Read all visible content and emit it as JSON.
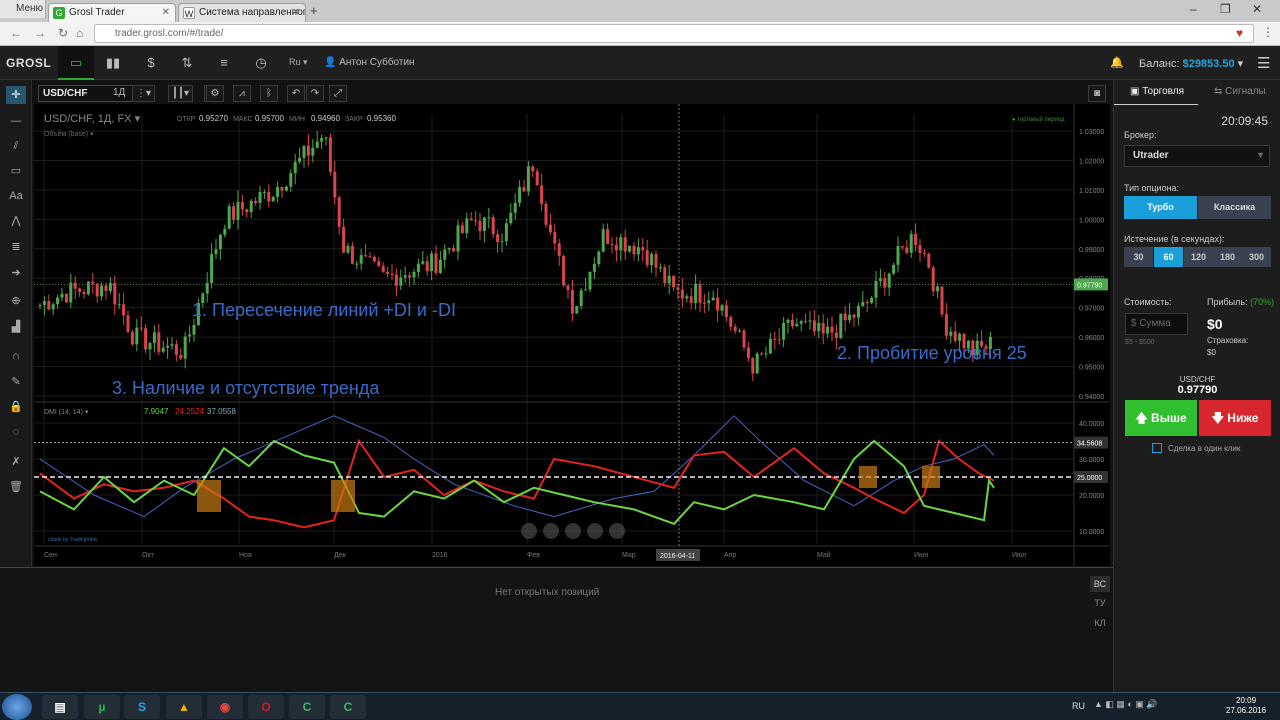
{
  "browser": {
    "menu_label": "Меню",
    "tabs": [
      {
        "label": "Grosl Trader",
        "icon": "grosl-icon",
        "color": "#31a82f"
      },
      {
        "label": "Система направленного д",
        "icon": "wikipedia-icon",
        "color": "#888888"
      }
    ],
    "url": "trader.grosl.com/#/trade/"
  },
  "app": {
    "logo": "GROSL",
    "language": "Ru",
    "user": "Антон Субботин",
    "balance_label": "Баланс:",
    "balance_value": "$29853.50"
  },
  "chart_header": {
    "symbol": "USD/CHF",
    "interval": "1Д",
    "title": "USD/CHF, 1Д, FX",
    "open_label": "ОТКР",
    "open": "0.95270",
    "high_label": "МАКС",
    "high": "0.95700",
    "low_label": "МИН",
    "low": "0.94960",
    "close_label": "ЗАКР",
    "close": "0.95360",
    "volume_label": "Объём (base)",
    "trading_period": "торговый период",
    "current_price": "0.97790"
  },
  "dmi_header": {
    "label": "DMI (14, 14)",
    "plus_di": "7.9047",
    "minus_di": "24.2524",
    "adx": "37.0558",
    "level_label": "34.5608",
    "threshold_label": "25.0000"
  },
  "annotations": [
    "1. Пересечение линий +DI и  -DI",
    "2. Пробитие уровня 25",
    "3. Наличие и отсутствие тренда"
  ],
  "price_axis": [
    "1.03000",
    "1.02000",
    "1.01000",
    "1.00000",
    "0.99000",
    "0.98000",
    "0.97000",
    "0.96000",
    "0.95000",
    "0.94000"
  ],
  "dmi_axis": [
    "40.0000",
    "30.0000",
    "20.0000",
    "10.0000"
  ],
  "time_axis": [
    "Сен",
    "Окт",
    "Ноя",
    "Дек",
    "2016",
    "Фев",
    "Мар",
    "Апр",
    "Май",
    "Июн",
    "Июл"
  ],
  "crosshair_date": "2016-04-11",
  "watermark": "charts by TradingView",
  "bottom": {
    "no_positions": "Нет открытых позиций",
    "tabs": [
      "ВС",
      "ТУ",
      "КЛ"
    ]
  },
  "panel": {
    "tabs": [
      "Торговля",
      "Сигналы"
    ],
    "time": "20:09:45",
    "broker_label": "Брокер:",
    "broker": "Utrader",
    "option_type_label": "Тип опциона:",
    "option_types": [
      "Турбо",
      "Классика"
    ],
    "expiry_label": "Истечение (в секундах):",
    "expiries": [
      "30",
      "60",
      "120",
      "180",
      "300"
    ],
    "cost_label": "Стоимость:",
    "profit_label": "Прибыль:",
    "profit_pct": "(70%)",
    "amount_placeholder": "$ Сумма",
    "amount_range": "$5 - $500",
    "profit_value": "$0",
    "insurance_label": "Страховка:",
    "insurance_value": "$0",
    "pair": "USD/CHF",
    "price": "0.97790",
    "up_label": "Выше",
    "down_label": "Ниже",
    "one_click_label": "Сделка в один клик"
  },
  "taskbar": {
    "lang": "RU",
    "time": "20:09",
    "date": "27.06.2016"
  },
  "colors": {
    "bull": "#4ea84e",
    "bear": "#d9454a",
    "plus_di": "#6bd640",
    "minus_di": "#e3231f",
    "adx": "#4a63c9",
    "buy": "#2fbf2f",
    "sell": "#d8262f",
    "accent": "#1b9fd8"
  }
}
